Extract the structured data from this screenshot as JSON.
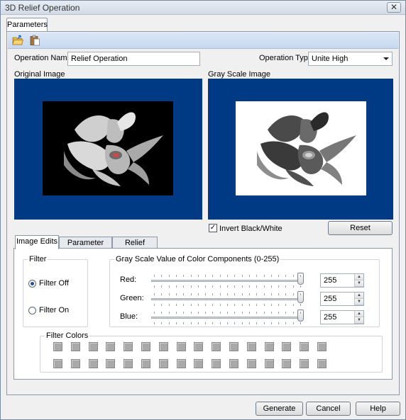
{
  "window": {
    "title": "3D Relief Operation",
    "close_glyph": "✕"
  },
  "tabs": {
    "parameters": "Parameters"
  },
  "toolbar": {
    "icons": [
      "open-folder-icon",
      "paste-icon"
    ]
  },
  "operation": {
    "name_label": "Operation Name:",
    "name_value": "Relief Operation",
    "type_label": "Operation Type:",
    "type_value": "Unite High"
  },
  "images": {
    "original_label": "Original Image",
    "grayscale_label": "Gray Scale Image",
    "panel_color": "#003a84"
  },
  "invert": {
    "label": "Invert Black/White",
    "checked": true
  },
  "reset_label": "Reset",
  "subtabs": [
    "Image Edits",
    "Parameter Edits",
    "Relief Curves"
  ],
  "filter": {
    "group_label": "Filter",
    "off_label": "Filter Off",
    "on_label": "Filter On",
    "selected": "Filter Off"
  },
  "grayscale": {
    "group_label": "Gray Scale Value of Color Components (0-255)",
    "channels": [
      {
        "label": "Red:",
        "value": "255"
      },
      {
        "label": "Green:",
        "value": "255"
      },
      {
        "label": "Blue:",
        "value": "255"
      }
    ]
  },
  "filter_colors": {
    "label": "Filter Colors",
    "swatch_color": "#a9a9a9"
  },
  "buttons": {
    "generate": "Generate",
    "cancel": "Cancel",
    "help": "Help"
  }
}
